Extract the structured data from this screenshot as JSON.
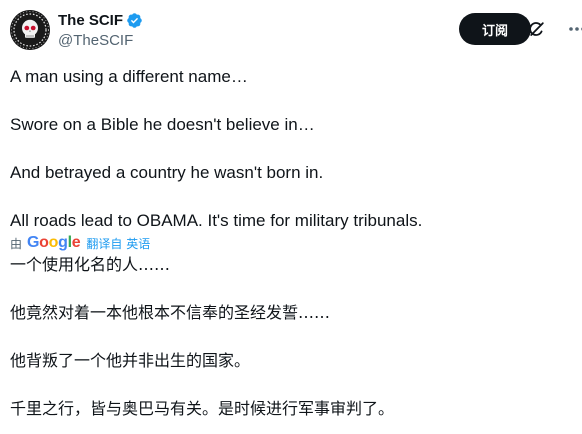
{
  "author": {
    "display_name": "The SCIF",
    "handle": "@TheSCIF",
    "verified_icon": "verified-badge-icon",
    "avatar_icon": "skull-avatar"
  },
  "actions": {
    "subscribe_label": "订阅",
    "grok_icon": "grok-icon",
    "more_icon": "more-icon"
  },
  "post": {
    "lines": [
      "A man using a different name…",
      "Swore on a Bible he doesn't believe in…",
      "And betrayed a country he wasn't born in.",
      "All roads lead to OBAMA. It's time for military tribunals."
    ]
  },
  "translation": {
    "by_label": "由",
    "provider": "Google",
    "action_label": "翻译自 英语",
    "lines": [
      "一个使用化名的人……",
      "他竟然对着一本他根本不信奉的圣经发誓……",
      "他背叛了一个他并非出生的国家。",
      "千里之行，皆与奥巴马有关。是时候进行军事审判了。"
    ]
  },
  "colors": {
    "text_primary": "#0f1419",
    "text_secondary": "#536471",
    "accent": "#1d9bf0",
    "button_bg": "#0f1419"
  }
}
